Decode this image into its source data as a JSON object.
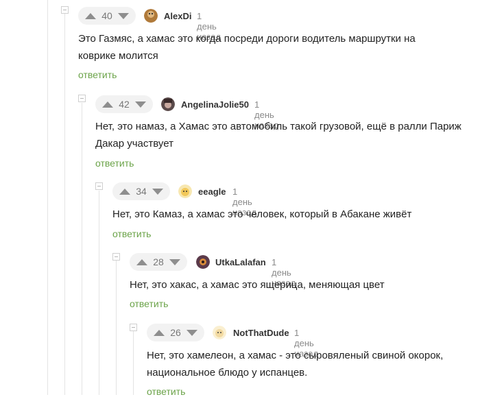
{
  "reply_label": "ответить",
  "comments": [
    {
      "score": "40",
      "username": "AlexDi",
      "time": "1 день назад",
      "text_lines": [
        "Это Газмяс, а хамас это когда посреди дороги водитель маршрутки на",
        "коврике молится"
      ],
      "avatar_color": "#b07a3a"
    },
    {
      "score": "42",
      "username": "AngelinaJolie50",
      "time": "1 день назад",
      "text_lines": [
        "Нет, это намаз, а Хамас это автомобиль такой грузовой, ещё в ралли Париж",
        "Дакар участвует"
      ],
      "avatar_color": "#5a4a4a"
    },
    {
      "score": "34",
      "username": "eeagle",
      "time": "1 день назад",
      "text_lines": [
        "Нет, это Камаз, а хамас это человек, который в Абакане живёт"
      ],
      "avatar_color": "#f2d27a"
    },
    {
      "score": "28",
      "username": "UtkaLalafan",
      "time": "1 день назад",
      "text_lines": [
        "Нет, это хакас, а хамас это ящерица, меняющая цвет"
      ],
      "avatar_color": "#5b3a4a"
    },
    {
      "score": "26",
      "username": "NotThatDude",
      "time": "1 день назад",
      "text_lines": [
        "Нет, это хамелеон, а хамас - это сыровяленый свиной окорок,",
        "национальное блюдо у испанцев."
      ],
      "avatar_color": "#f2d9a0"
    }
  ]
}
